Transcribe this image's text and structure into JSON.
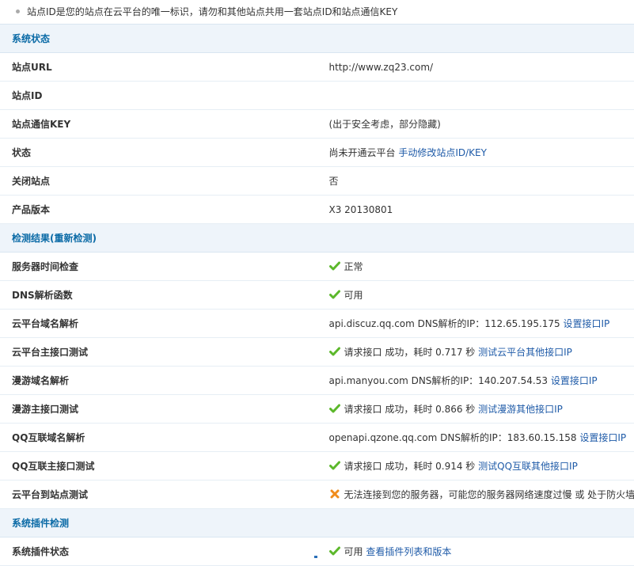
{
  "note": "站点ID是您的站点在云平台的唯一标识，请勿和其他站点共用一套站点ID和站点通信KEY",
  "sections": {
    "status": "系统状态",
    "check": "检测结果(重新检测)",
    "plugin": "系统插件检测"
  },
  "status": {
    "url_label": "站点URL",
    "url_value": "http://www.zq23.com/",
    "id_label": "站点ID",
    "id_value": "",
    "key_label": "站点通信KEY",
    "key_value": "(出于安全考虑，部分隐藏)",
    "state_label": "状态",
    "state_value": "尚未开通云平台",
    "state_link": "手动修改站点ID/KEY",
    "close_label": "关闭站点",
    "close_value": "否",
    "ver_label": "产品版本",
    "ver_value": "X3 20130801"
  },
  "check": {
    "time_label": "服务器时间检查",
    "time_value": "正常",
    "dns_label": "DNS解析函数",
    "dns_value": "可用",
    "cloud_dns_label": "云平台域名解析",
    "cloud_dns_value": "api.discuz.qq.com DNS解析的IP：112.65.195.175",
    "cloud_dns_link": "设置接口IP",
    "cloud_api_label": "云平台主接口测试",
    "cloud_api_value": "请求接口 成功，耗时 0.717 秒",
    "cloud_api_link": "测试云平台其他接口IP",
    "manyou_dns_label": "漫游域名解析",
    "manyou_dns_value": "api.manyou.com DNS解析的IP：140.207.54.53",
    "manyou_dns_link": "设置接口IP",
    "manyou_api_label": "漫游主接口测试",
    "manyou_api_value": "请求接口 成功，耗时 0.866 秒",
    "manyou_api_link": "测试漫游其他接口IP",
    "qq_dns_label": "QQ互联域名解析",
    "qq_dns_value": "openapi.qzone.qq.com DNS解析的IP：183.60.15.158",
    "qq_dns_link": "设置接口IP",
    "qq_api_label": "QQ互联主接口测试",
    "qq_api_value": "请求接口 成功，耗时 0.914 秒",
    "qq_api_link": "测试QQ互联其他接口IP",
    "site_label": "云平台到站点测试",
    "site_value": "无法连接到您的服务器，可能您的服务器网络速度过慢 或 处于防火墙后端"
  },
  "plugin": {
    "state_label": "系统插件状态",
    "state_value": "可用",
    "state_link": "查看插件列表和版本"
  },
  "icons": {
    "ok": "check-icon",
    "fail": "cross-icon"
  },
  "colors": {
    "ok": "#5cb82b",
    "fail": "#f08c1c",
    "link": "#1f5ba8",
    "section": "#0a6aa6"
  }
}
